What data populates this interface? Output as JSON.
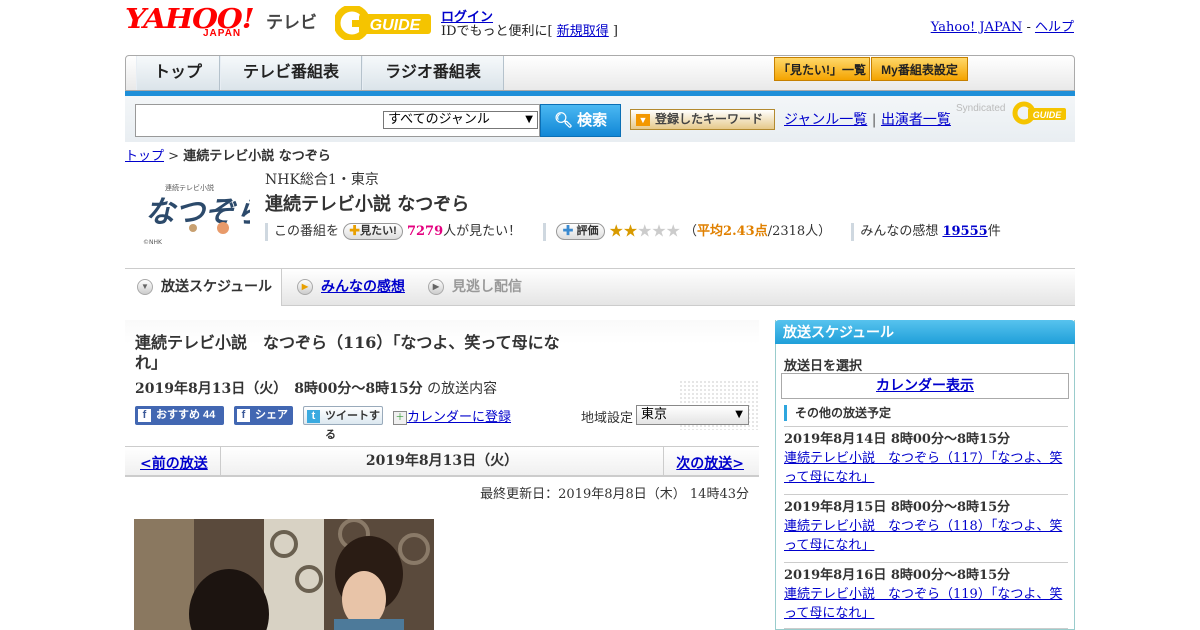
{
  "header": {
    "logo_yahoo": "YAHOO!",
    "logo_japan": "JAPAN",
    "logo_tv": "テレビ",
    "gguide": "G GUIDE",
    "login": "ログイン",
    "login_sub_prefix": "IDでもっと便利に[ ",
    "signup": "新規取得",
    "login_sub_suffix": " ]",
    "yahoo_japan_link": "Yahoo! JAPAN",
    "separator": " - ",
    "help_link": "ヘルプ"
  },
  "nav": {
    "tabs": [
      "トップ",
      "テレビ番組表",
      "ラジオ番組表"
    ],
    "mitai_list": "「見たい!」一覧",
    "my_schedule": "My番組表設定"
  },
  "search": {
    "genre_selected": "すべてのジャンル",
    "search_button": "検索",
    "keyword_button": "登録したキーワード",
    "genre_list": "ジャンル一覧",
    "divider": " | ",
    "cast_list": "出演者一覧",
    "syndicated": "Syndicated"
  },
  "breadcrumb": {
    "top": "トップ",
    "sep": " > ",
    "current": "連続テレビ小説 なつぞら"
  },
  "program": {
    "thumb_title": "なつぞら",
    "thumb_sub": "連続テレビ小説",
    "thumb_credit": "©NHK",
    "channel": "NHK総合1・東京",
    "title": "連続テレビ小説 なつぞら",
    "watch_prefix": "この番組を",
    "watch_button": "見たい!",
    "watch_count": "7279",
    "watch_suffix": "人が見たい！",
    "rating_button": "評価",
    "rating_value": 2.43,
    "rating_open": "（",
    "rating_label": "平均2.43点",
    "rating_count": "/2318人）",
    "impressions_label": "みんなの感想",
    "impressions_count": "19555",
    "impressions_suffix": "件"
  },
  "subtabs": {
    "schedule": "放送スケジュール",
    "reviews": "みんなの感想",
    "missed": "見逃し配信"
  },
  "episode": {
    "title": "連続テレビ小説　なつぞら（116）「なつよ、笑って母になれ」",
    "date": "2019年8月13日（火）　8時00分～8時15分",
    "date_suffix": "の放送内容",
    "fb_recommend": "おすすめ 44",
    "fb_share": "シェア",
    "tweet": "ツイートする",
    "calendar_register": "カレンダーに登録",
    "region_label": "地域設定",
    "region_selected": "東京"
  },
  "pager": {
    "prev": "<前の放送",
    "date": "2019年8月13日（火）",
    "next": "次の放送>",
    "updated": "最終更新日：2019年8月8日（木）  14時43分"
  },
  "sidebar": {
    "heading": "放送スケジュール",
    "pick_date": "放送日を選択",
    "calendar": "カレンダー表示",
    "other_heading": "その他の放送予定",
    "items": [
      {
        "date": "2019年8月14日  8時00分～8時15分",
        "title": "連続テレビ小説　なつぞら（117）「なつよ、笑って母になれ」"
      },
      {
        "date": "2019年8月15日  8時00分～8時15分",
        "title": "連続テレビ小説　なつぞら（118）「なつよ、笑って母になれ」"
      },
      {
        "date": "2019年8月16日  8時00分～8時15分",
        "title": "連続テレビ小説　なつぞら（119）「なつよ、笑って母になれ」"
      }
    ]
  },
  "colors": {
    "accent_blue": "#1e8fd8",
    "yahoo_red": "#ff0000",
    "gguide_yellow": "#f5c400",
    "watch_pink": "#e4007f",
    "rating_orange": "#e08000"
  }
}
